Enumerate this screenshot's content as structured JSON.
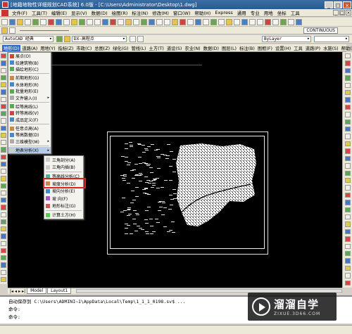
{
  "window": {
    "title": "[地籍地物性详细规划CAD系统] 6.0版 - [C:\\Users\\Administrator\\Desktop\\1.dwg]",
    "minimize": "_",
    "maximize": "□",
    "close": "×"
  },
  "menubar": {
    "items": [
      "文件(F)",
      "工具(T)",
      "编辑(E)",
      "显示(V)",
      "数据(D)",
      "绘图(R)",
      "标注(N)",
      "修改(M)",
      "窗口(W)",
      "帮助(H)",
      "Express",
      "通用",
      "专业",
      "用地",
      "坐标",
      "工具"
    ]
  },
  "toolbar": {
    "text_style": "AutoCAD 经典",
    "layer": "DX-高程点",
    "linetype": "ByLayer",
    "layer_button": "CONTINUOUS"
  },
  "cass_menu": {
    "items": [
      "地形(D)",
      "道路(A)",
      "用地(Y)",
      "指标(Z)",
      "市政(C)",
      "总图(Z)",
      "绿化(G)",
      "管线(L)",
      "土方(T)",
      "道设(S)",
      "农业(N)",
      "数据(D)",
      "图层(L)",
      "标注(B)",
      "图框(F)",
      "设置(H)",
      "工具",
      "道路(P)",
      "水施(S)",
      "帮助(H)"
    ]
  },
  "dropdown_main": {
    "items": [
      {
        "label": "展点(O)",
        "arrow": ""
      },
      {
        "label": "绘建筑物(B)",
        "arrow": ""
      },
      {
        "label": "描绘地形(C)",
        "arrow": ""
      },
      {
        "label": "",
        "sep": true
      },
      {
        "label": "前期地形(G)",
        "arrow": ""
      },
      {
        "label": "水体地形(R)",
        "arrow": ""
      },
      {
        "label": "批量地形(E)",
        "arrow": ""
      },
      {
        "label": "文件输入(I)",
        "arrow": "▸"
      },
      {
        "label": "",
        "sep": true
      },
      {
        "label": "绘等高线(L)",
        "arrow": ""
      },
      {
        "label": "转等高线(V)",
        "arrow": ""
      },
      {
        "label": "成品定义(F)",
        "arrow": ""
      },
      {
        "label": "",
        "sep": true
      },
      {
        "label": "任意点高(A)",
        "arrow": ""
      },
      {
        "label": "等高数据(D)",
        "arrow": ""
      },
      {
        "label": "三维模型(M)",
        "arrow": "▸"
      },
      {
        "label": "",
        "sep": true
      },
      {
        "label": "地表分析(X)",
        "arrow": "▸"
      }
    ]
  },
  "dropdown_sub": {
    "items": [
      {
        "label": "三角剖分(A)",
        "icon": "#ccc"
      },
      {
        "label": "三角内插(B)",
        "icon": "#ccc"
      },
      {
        "label": "",
        "sep": true
      },
      {
        "label": "等高线分析(C)",
        "icon": "#5a9"
      },
      {
        "label": "坡度分析(D)",
        "icon": "#c84"
      },
      {
        "label": "坡向分析(E)",
        "icon": "#48c"
      },
      {
        "label": "坡   向(F)",
        "icon": "#a5c"
      },
      {
        "label": "地形标注(G)",
        "icon": "#c55"
      },
      {
        "label": "",
        "sep": true
      },
      {
        "label": "计算土方(H)",
        "icon": "#5c5"
      }
    ]
  },
  "tabs": {
    "nav": [
      "|◂",
      "◂",
      "▸",
      "▸|"
    ],
    "model": "Model",
    "layout1": "Layout1"
  },
  "command": {
    "line1": "自动保存到 C:\\Users\\ADMINI~1\\AppData\\Local\\Temp\\1_1_1_0198.sv$ ...",
    "line2": "命令:",
    "line3": "命令:"
  },
  "watermark": {
    "cn": "溜溜自学",
    "en": "ZIXUE.3D66.COM"
  }
}
